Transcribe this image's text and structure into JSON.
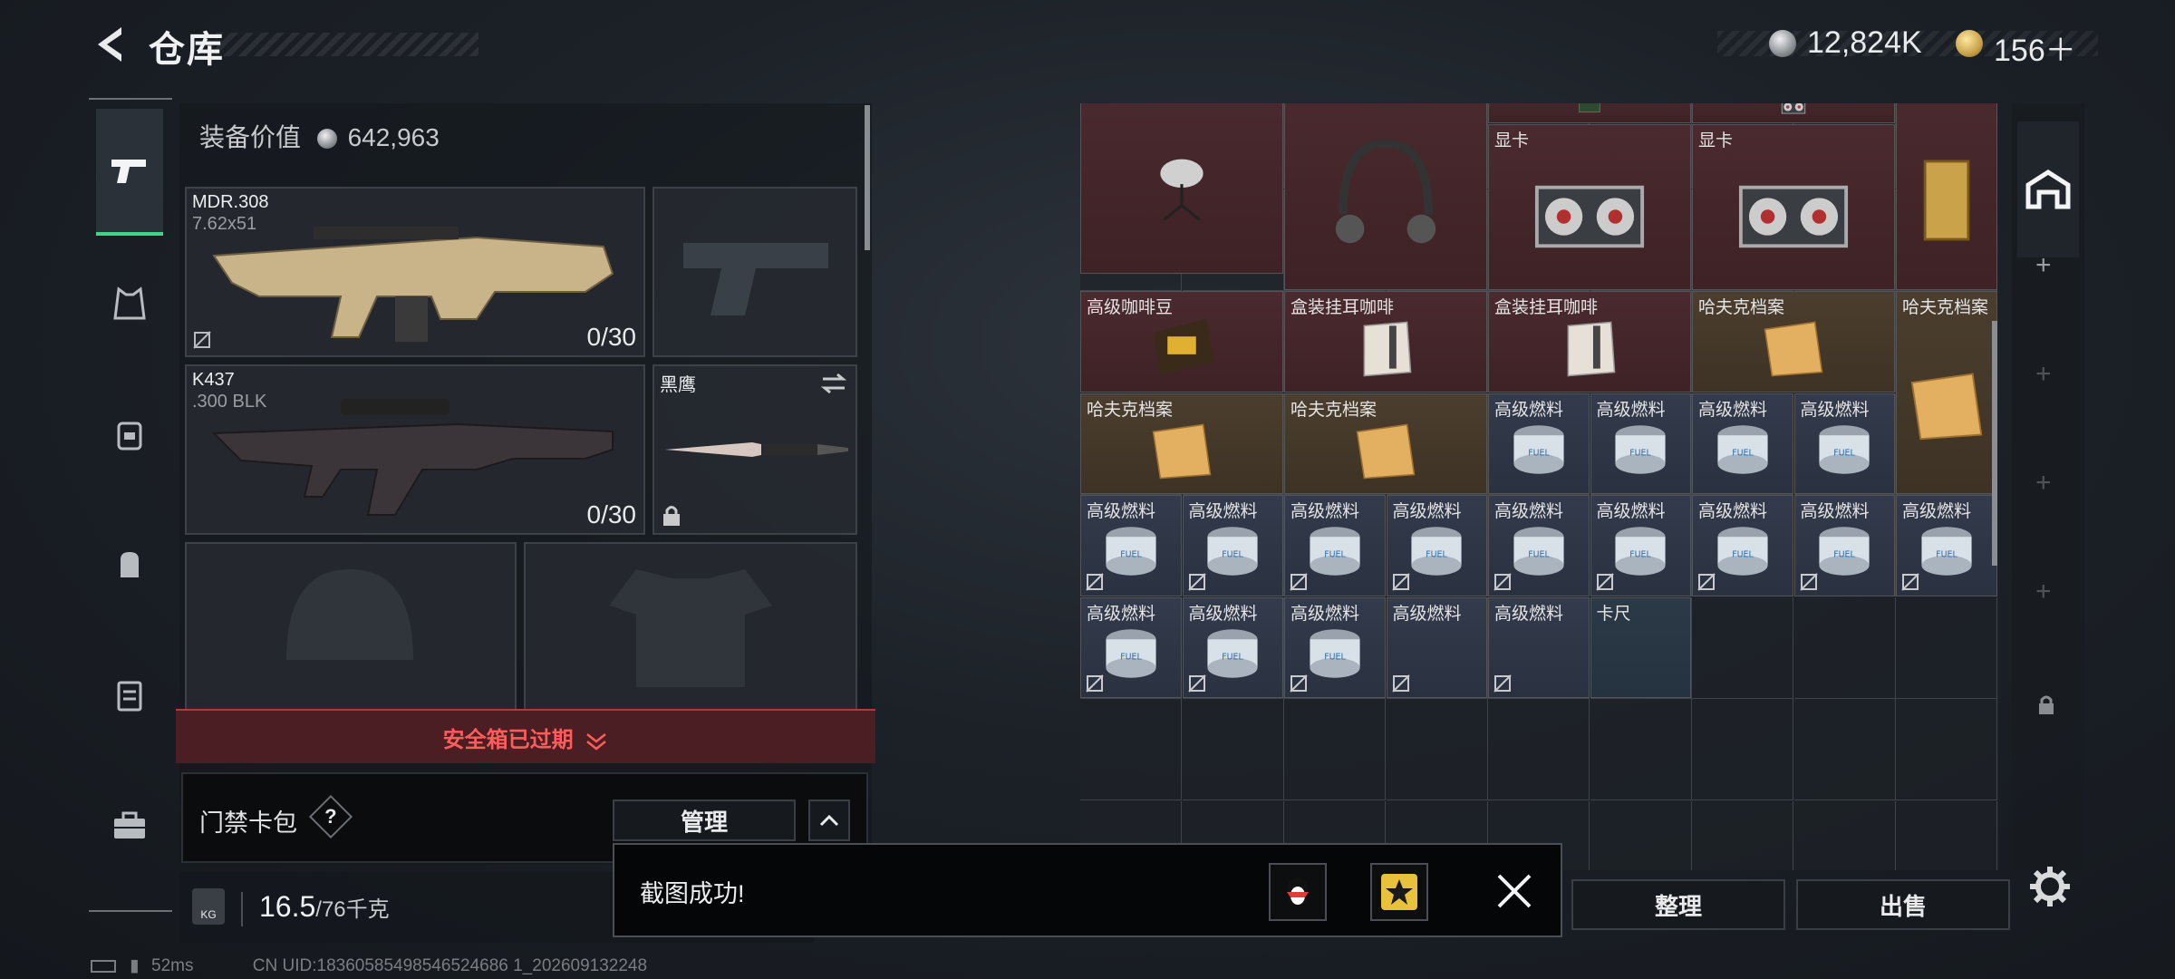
{
  "header": {
    "title": "仓库",
    "silver_amount": "12,824K",
    "gold_amount": "156＋"
  },
  "equipment": {
    "value_label": "装备价值",
    "value": "642,963",
    "primary": {
      "name": "MDR.308",
      "caliber": "7.62x51",
      "ammo": "0/30"
    },
    "secondary": {
      "name": "K437",
      "caliber": ".300 BLK",
      "ammo": "0/30"
    },
    "melee": {
      "name": "黑鹰"
    },
    "safe_box_status": "安全箱已过期",
    "card_pack_label": "门禁卡包",
    "help_glyph": "?",
    "manage_label": "管理",
    "weight": "16.5",
    "weight_cap": "/76千克"
  },
  "grid": {
    "items": [
      {
        "label": "",
        "style": "red",
        "icon": "satellite-dish"
      },
      {
        "label": "",
        "style": "red",
        "icon": "headset"
      },
      {
        "label": "",
        "style": "red",
        "icon": "case"
      },
      {
        "label": "",
        "style": "red",
        "icon": "gpu"
      },
      {
        "label": "",
        "style": "red",
        "icon": "gold-bar"
      },
      {
        "label": "显卡",
        "style": "red",
        "icon": "gpu"
      },
      {
        "label": "显卡",
        "style": "red",
        "icon": "gpu"
      },
      {
        "label": "高级咖啡豆",
        "style": "red",
        "icon": "coffee-bag"
      },
      {
        "label": "盒装挂耳咖啡",
        "style": "red",
        "icon": "coffee-box"
      },
      {
        "label": "盒装挂耳咖啡",
        "style": "red",
        "icon": "coffee-box"
      },
      {
        "label": "哈夫克档案",
        "style": "gold",
        "icon": "folder"
      },
      {
        "label": "哈夫克档案",
        "style": "gold",
        "icon": "folder"
      },
      {
        "label": "哈夫克档案",
        "style": "gold",
        "icon": "folder"
      },
      {
        "label": "哈夫克档案",
        "style": "gold",
        "icon": "folder"
      },
      {
        "label": "高级燃料",
        "style": "blue",
        "icon": "fuel-can"
      },
      {
        "label": "卡尺",
        "style": "cyan",
        "icon": "caliper"
      }
    ]
  },
  "actions": {
    "sort_label": "整理",
    "sell_label": "出售"
  },
  "toast": {
    "message": "截图成功!"
  },
  "status": {
    "ping": "52ms",
    "uid": "CN UID:18360585498546524686 1_202609132248"
  },
  "colors": {
    "accent_green": "#3fd68a",
    "alert_red": "#ff5c5c"
  }
}
